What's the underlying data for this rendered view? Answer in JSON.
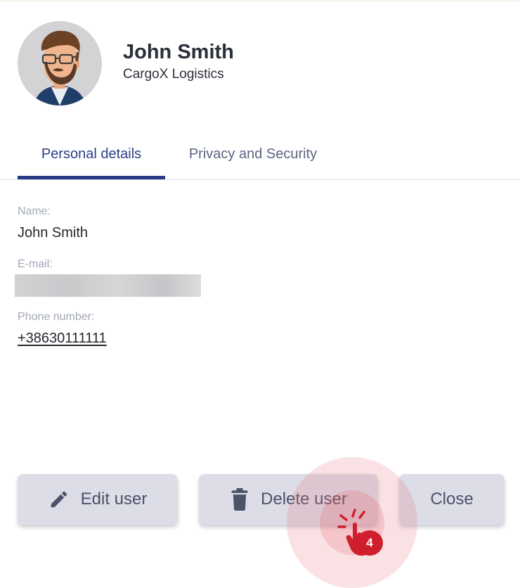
{
  "profile": {
    "name": "John Smith",
    "company": "CargoX Logistics",
    "avatar_icon": "bearded-man-avatar"
  },
  "tabs": [
    {
      "label": "Personal details",
      "active": true
    },
    {
      "label": "Privacy and Security",
      "active": false
    }
  ],
  "fields": {
    "name_label": "Name:",
    "name_value": "John Smith",
    "email_label": "E-mail:",
    "phone_label": "Phone number:",
    "phone_value": "+38630111111"
  },
  "actions": {
    "edit_label": "Edit user",
    "edit_icon": "pencil-icon",
    "delete_label": "Delete user",
    "delete_icon": "trash-icon",
    "close_label": "Close"
  },
  "tutorial": {
    "step": "4",
    "pointer_icon": "hand-click-icon"
  },
  "colors": {
    "accent": "#283a85",
    "button_bg": "#dcdde6",
    "click_marker": "#cf1f2c"
  }
}
